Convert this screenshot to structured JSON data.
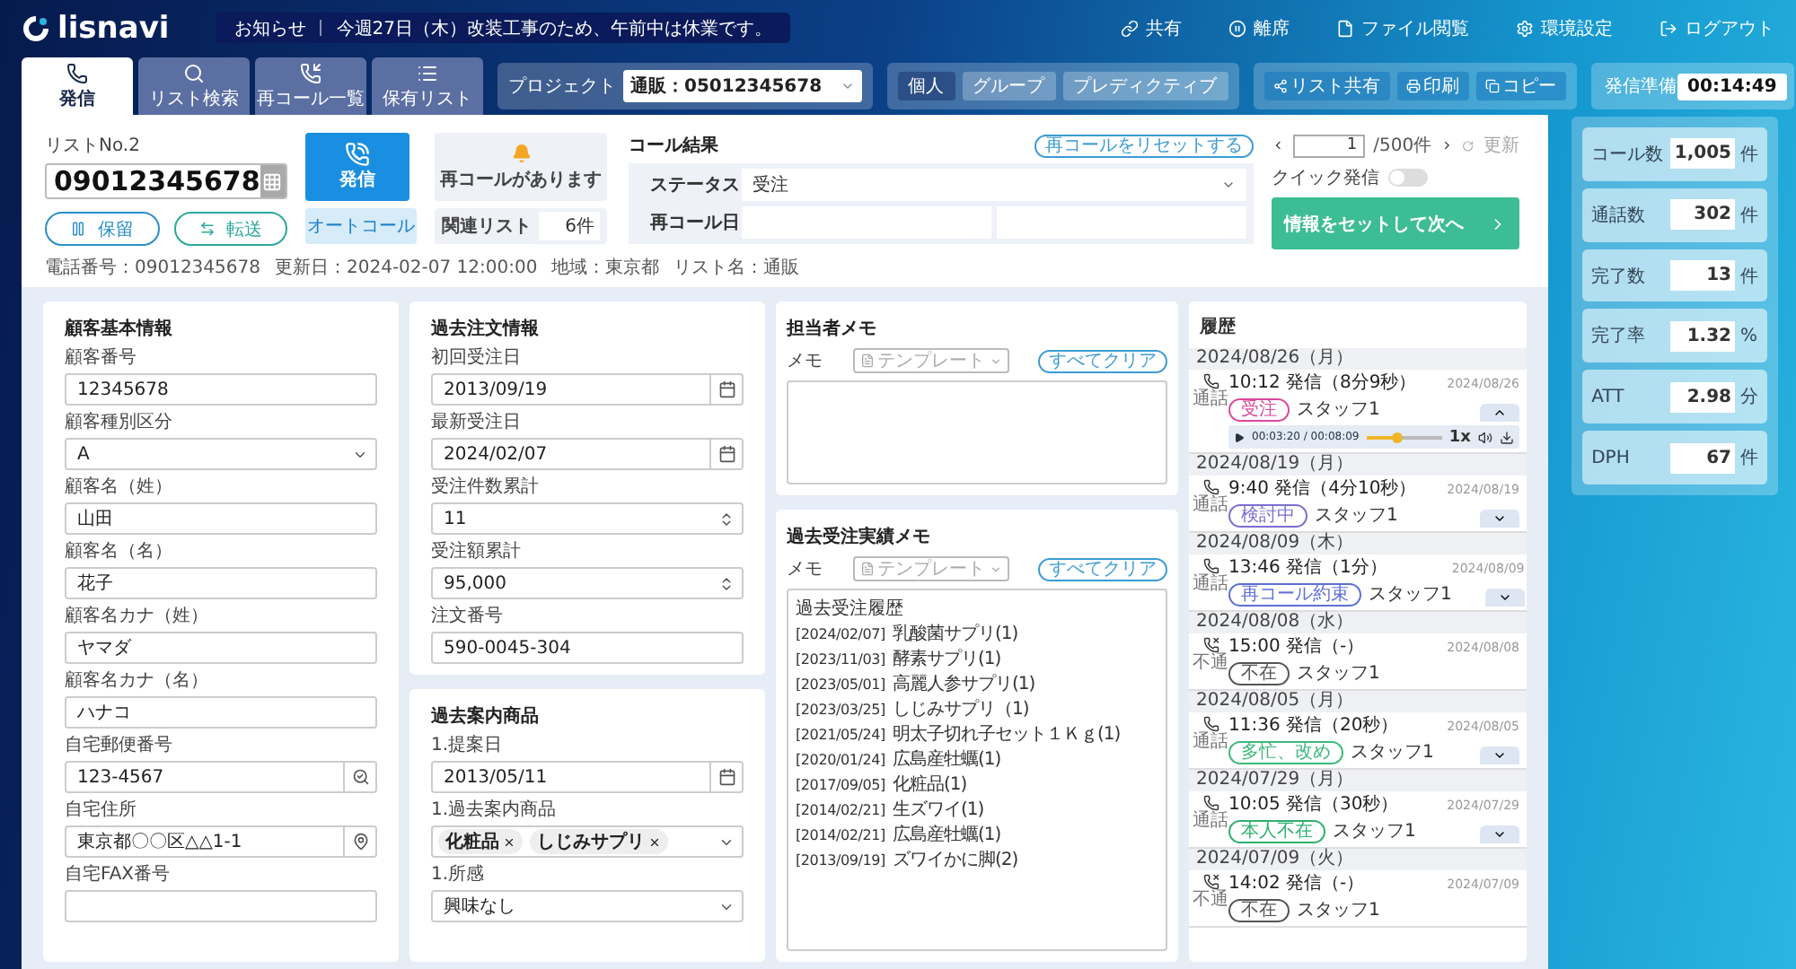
{
  "app": {
    "logo": "lisnavi"
  },
  "notice": {
    "label": "お知らせ",
    "text": "今週27日（木）改装工事のため、午前中は休業です。"
  },
  "nav": [
    {
      "label": "共有",
      "kind": "link"
    },
    {
      "label": "離席",
      "kind": "away"
    },
    {
      "label": "ファイル閲覧",
      "kind": "file"
    },
    {
      "label": "環境設定",
      "kind": "settings"
    },
    {
      "label": "ログアウト",
      "kind": "logout"
    }
  ],
  "tabs": [
    {
      "label": "発信",
      "kind": "call",
      "selected": true
    },
    {
      "label": "リスト検索",
      "kind": "search",
      "selected": false
    },
    {
      "label": "再コール一覧",
      "kind": "recall",
      "selected": false
    },
    {
      "label": "保有リスト",
      "kind": "list",
      "selected": false
    }
  ],
  "project": {
    "label": "プロジェクト",
    "value": "通販：05012345678"
  },
  "modes": [
    {
      "label": "個人",
      "selected": true
    },
    {
      "label": "グループ",
      "selected": false
    },
    {
      "label": "プレディクティブ",
      "selected": false
    }
  ],
  "actions": [
    {
      "label": "リスト共有",
      "kind": "share"
    },
    {
      "label": "印刷",
      "kind": "print"
    },
    {
      "label": "コピー",
      "kind": "copy"
    }
  ],
  "ready": {
    "label": "発信準備",
    "time": "00:14:49"
  },
  "caller": {
    "list_no": "リストNo.2",
    "phone": "09012345678",
    "call": "発信",
    "hold": "保留",
    "transfer": "転送",
    "auto": "オートコール",
    "recall_notice": "再コールがあります",
    "related_label": "関連リスト",
    "related_value": "6件",
    "meta": [
      "電話番号：09012345678",
      "更新日：2024-02-07 12:00:00",
      "地域：東京都",
      "リスト名：通販"
    ]
  },
  "call_result": {
    "title": "コール結果",
    "reset": "再コールをリセットする",
    "status_label": "ステータス",
    "status": "受注",
    "recall_label": "再コール日"
  },
  "pager": {
    "page": "1",
    "total": "/500件",
    "refresh": "更新"
  },
  "quick": {
    "label": "クイック発信",
    "on": false
  },
  "next_button": "情報をセットして次へ",
  "customer": {
    "title": "顧客基本情報",
    "fields": [
      {
        "label": "顧客番号",
        "value": "12345678",
        "kind": "text"
      },
      {
        "label": "顧客種別区分",
        "value": "A",
        "kind": "select"
      },
      {
        "label": "顧客名（姓）",
        "value": "山田",
        "kind": "text"
      },
      {
        "label": "顧客名（名）",
        "value": "花子",
        "kind": "text"
      },
      {
        "label": "顧客名カナ（姓）",
        "value": "ヤマダ",
        "kind": "text"
      },
      {
        "label": "顧客名カナ（名）",
        "value": "ハナコ",
        "kind": "text"
      },
      {
        "label": "自宅郵便番号",
        "value": "123-4567",
        "kind": "postal"
      },
      {
        "label": "自宅住所",
        "value": "東京都〇〇区△△1-1",
        "kind": "address"
      },
      {
        "label": "自宅FAX番号",
        "kind": "text"
      }
    ]
  },
  "orders": {
    "title": "過去注文情報",
    "fields": [
      {
        "label": "初回受注日",
        "value": "2013/09/19",
        "kind": "date"
      },
      {
        "label": "最新受注日",
        "value": "2024/02/07",
        "kind": "date"
      },
      {
        "label": "受注件数累計",
        "value": "11",
        "kind": "number"
      },
      {
        "label": "受注額累計",
        "value": "95,000",
        "kind": "number"
      },
      {
        "label": "注文番号",
        "value": "590-0045-304",
        "kind": "text"
      }
    ]
  },
  "guides": {
    "title": "過去案内商品",
    "fields": [
      {
        "label": "1.提案日",
        "value": "2013/05/11",
        "kind": "date"
      },
      {
        "label": "1.過去案内商品",
        "kind": "tags",
        "tags": [
          "化粧品",
          "しじみサプリ"
        ]
      },
      {
        "label": "1.所感",
        "value": "興味なし",
        "kind": "select"
      }
    ]
  },
  "staff_memo": {
    "title": "担当者メモ",
    "label": "メモ",
    "template": "テンプレート",
    "clear": "すべてクリア"
  },
  "order_memo": {
    "title": "過去受注実績メモ",
    "label": "メモ",
    "template": "テンプレート",
    "clear": "すべてクリア",
    "heading": "過去受注履歴",
    "lines": [
      {
        "date": "[2024/02/07]",
        "item": "乳酸菌サプリ(1)"
      },
      {
        "date": "[2023/11/03]",
        "item": "酵素サプリ(1)"
      },
      {
        "date": "[2023/05/01]",
        "item": "高麗人参サプリ(1)"
      },
      {
        "date": "[2023/03/25]",
        "item": "しじみサプリ（1)"
      },
      {
        "date": "[2021/05/24]",
        "item": "明太子切れ子セット１Ｋｇ(1)"
      },
      {
        "date": "[2020/01/24]",
        "item": "広島産牡蠣(1)"
      },
      {
        "date": "[2017/09/05]",
        "item": "化粧品(1)"
      },
      {
        "date": "[2014/02/21]",
        "item": "生ズワイ(1)"
      },
      {
        "date": "[2014/02/21]",
        "item": "広島産牡蠣(1)"
      },
      {
        "date": "[2013/09/19]",
        "item": "ズワイかに脚(2)"
      }
    ]
  },
  "history": {
    "title": "履歴",
    "entries": [
      {
        "date": "2024/08/26（月）",
        "kind": "connected",
        "type_label": "通話",
        "time": "10:12 発信（8分9秒）",
        "status": "受注",
        "color": "#d9489b",
        "staff": "スタッフ1",
        "stamp": "2024/08/26",
        "expanded": true,
        "player": {
          "time": "00:03:20 / 00:08:09",
          "level": 0.4,
          "speed": "1x"
        }
      },
      {
        "date": "2024/08/19（月）",
        "kind": "connected",
        "type_label": "通話",
        "time": "9:40 発信（4分10秒）",
        "status": "検討中",
        "color": "#7b6fd0",
        "staff": "スタッフ1",
        "stamp": "2024/08/19",
        "expanded": false
      },
      {
        "date": "2024/08/09（木）",
        "kind": "connected",
        "type_label": "通話",
        "time": "13:46 発信（1分）",
        "status": "再コール約束",
        "color": "#5f6fd6",
        "staff": "スタッフ1",
        "stamp": "2024/08/09",
        "expanded": false
      },
      {
        "date": "2024/08/08（水）",
        "kind": "missed",
        "type_label": "不通",
        "time": "15:00 発信（-）",
        "status": "不在",
        "color": "#555555",
        "staff": "スタッフ1",
        "stamp": "2024/08/08"
      },
      {
        "date": "2024/08/05（月）",
        "kind": "connected",
        "type_label": "通話",
        "time": "11:36 発信（20秒）",
        "status": "多忙、改め",
        "color": "#3cb97a",
        "staff": "スタッフ1",
        "stamp": "2024/08/05",
        "expanded": false
      },
      {
        "date": "2024/07/29（月）",
        "kind": "connected",
        "type_label": "通話",
        "time": "10:05 発信（30秒）",
        "status": "本人不在",
        "color": "#2fb070",
        "staff": "スタッフ1",
        "stamp": "2024/07/29",
        "expanded": false
      },
      {
        "date": "2024/07/09（火）",
        "kind": "missed",
        "type_label": "不通",
        "time": "14:02 発信（-）",
        "status": "不在",
        "color": "#555555",
        "staff": "スタッフ1",
        "stamp": "2024/07/09"
      }
    ]
  },
  "stats": [
    {
      "label": "コール数",
      "value": "1,005",
      "unit": "件"
    },
    {
      "label": "通話数",
      "value": "302",
      "unit": "件"
    },
    {
      "label": "完了数",
      "value": "13",
      "unit": "件"
    },
    {
      "label": "完了率",
      "value": "1.32",
      "unit": "%"
    },
    {
      "label": "ATT",
      "value": "2.98",
      "unit": "分"
    },
    {
      "label": "DPH",
      "value": "67",
      "unit": "件"
    }
  ]
}
